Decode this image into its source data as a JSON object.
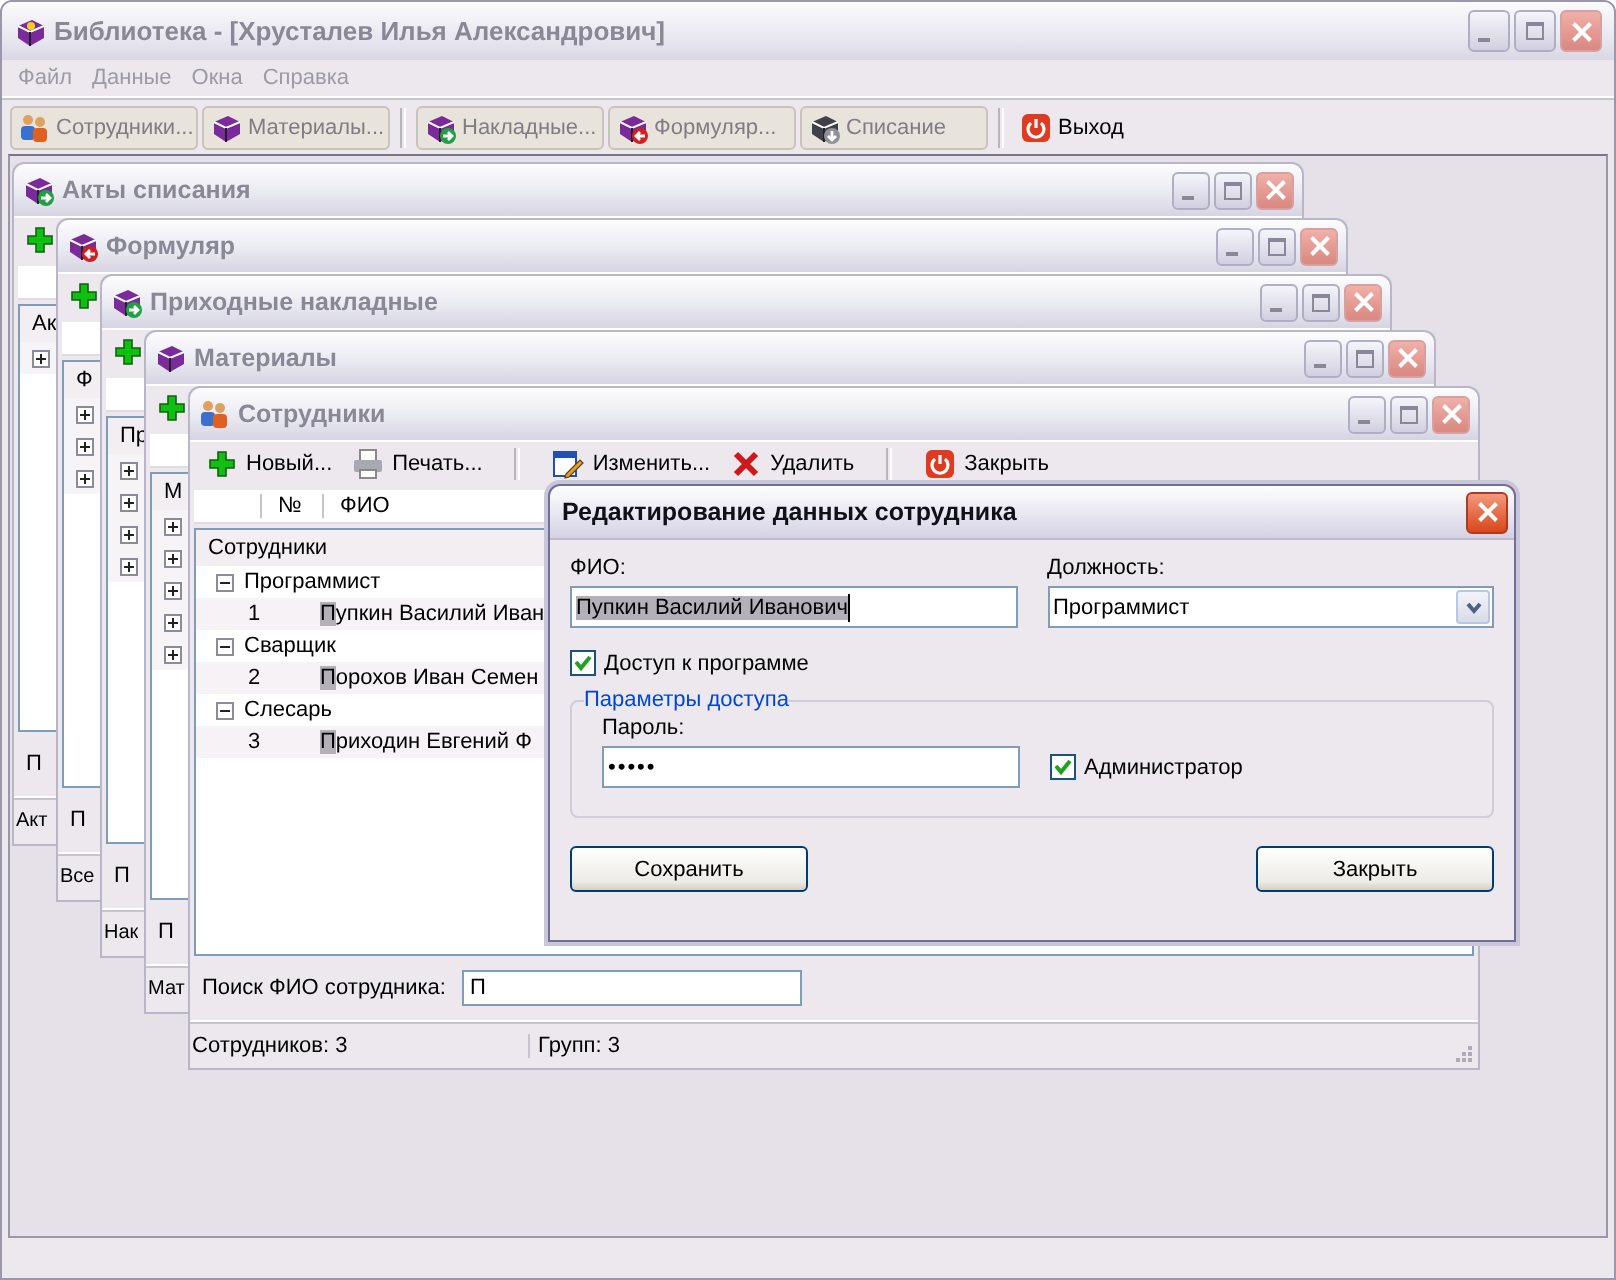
{
  "window": {
    "title": "Библиотека - [Хрусталев Илья Александрович]"
  },
  "menu": [
    {
      "label": "Файл",
      "disabled": true
    },
    {
      "label": "Данные",
      "disabled": true
    },
    {
      "label": "Окна",
      "disabled": true
    },
    {
      "label": "Справка",
      "disabled": true
    }
  ],
  "toolbar": [
    [
      {
        "label": "Сотрудники...",
        "disabled": true
      },
      {
        "label": "Материалы...",
        "disabled": true
      }
    ],
    [
      {
        "label": "Накладные...",
        "disabled": true
      },
      {
        "label": "Формуляр...",
        "disabled": true
      },
      {
        "label": "Списание",
        "disabled": true
      }
    ],
    [
      {
        "label": "Выход",
        "disabled": false
      }
    ]
  ],
  "child_windows": [
    {
      "title": "Акты списания",
      "tree_header": "Ак",
      "tree_nodes": [
        {
          "expanded": false
        }
      ],
      "search_label": "П",
      "status": "Акт"
    },
    {
      "title": "Формуляр",
      "tree_header": "Ф",
      "tree_nodes": [
        {
          "expanded": false
        },
        {
          "expanded": false
        },
        {
          "expanded": false
        }
      ],
      "search_label": "П",
      "status": "Все"
    },
    {
      "title": "Приходные накладные",
      "tree_header": "Пр",
      "tree_nodes": [
        {
          "expanded": false
        },
        {
          "expanded": false
        },
        {
          "expanded": false
        },
        {
          "expanded": false
        }
      ],
      "search_label": "П",
      "status": "Нак"
    },
    {
      "title": "Материалы",
      "tree_header": "М",
      "tree_nodes": [
        {
          "expanded": false
        },
        {
          "expanded": false
        },
        {
          "expanded": false
        },
        {
          "expanded": false
        },
        {
          "expanded": false
        }
      ],
      "search_label": "П",
      "status": "Мат"
    }
  ],
  "employees_window": {
    "title": "Сотрудники",
    "toolbar": [
      [
        {
          "label": "Новый..."
        },
        {
          "label": "Печать..."
        }
      ],
      [
        {
          "label": "Изменить..."
        },
        {
          "label": "Удалить"
        }
      ],
      [
        {
          "label": "Закрыть"
        }
      ]
    ],
    "columns": [
      "№",
      "ФИО"
    ],
    "tree_header": "Сотрудники",
    "groups": [
      {
        "name": "Программист",
        "expanded": true,
        "rows": [
          {
            "number": "1",
            "name": "Пупкин Василий Иван",
            "match": true
          }
        ]
      },
      {
        "name": "Сварщик",
        "expanded": true,
        "rows": [
          {
            "number": "2",
            "name": "Порохов Иван Семен",
            "match": true
          }
        ]
      },
      {
        "name": "Слесарь",
        "expanded": true,
        "rows": [
          {
            "number": "3",
            "name": "Приходин Евгений Ф",
            "match": true
          }
        ]
      }
    ],
    "search": {
      "label": "Поиск ФИО сотрудника:",
      "value": "П"
    },
    "status": [
      "Сотрудников: 3",
      "Групп: 3"
    ]
  },
  "dialog": {
    "title": "Редактирование данных сотрудника",
    "fio": {
      "label": "ФИО:",
      "value": "Пупкин Василий Иванович",
      "selected": true
    },
    "position": {
      "label": "Должность:",
      "value": "Программист"
    },
    "access": {
      "label": "Доступ к программе",
      "checked": true
    },
    "group_title": "Параметры доступа",
    "password": {
      "label": "Пароль:",
      "value": "•••••"
    },
    "admin": {
      "label": "Администратор",
      "checked": true
    },
    "buttons": [
      "Сохранить",
      "Закрыть"
    ]
  }
}
